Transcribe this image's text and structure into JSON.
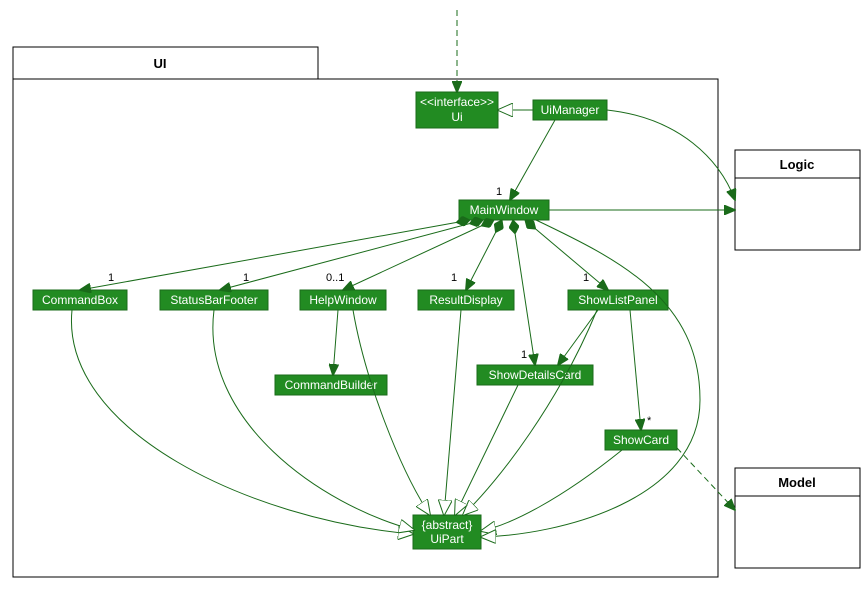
{
  "packages": {
    "ui": {
      "label": "UI"
    },
    "logic": {
      "label": "Logic"
    },
    "model": {
      "label": "Model"
    }
  },
  "classes": {
    "ui_iface": {
      "stereotype": "<<interface>>",
      "name": "Ui"
    },
    "uiManager": {
      "name": "UiManager"
    },
    "mainWindow": {
      "name": "MainWindow"
    },
    "commandBox": {
      "name": "CommandBox"
    },
    "statusBarFooter": {
      "name": "StatusBarFooter"
    },
    "helpWindow": {
      "name": "HelpWindow"
    },
    "resultDisplay": {
      "name": "ResultDisplay"
    },
    "showListPanel": {
      "name": "ShowListPanel"
    },
    "commandBuilder": {
      "name": "CommandBuilder"
    },
    "showDetailsCard": {
      "name": "ShowDetailsCard"
    },
    "showCard": {
      "name": "ShowCard"
    },
    "uiPart": {
      "stereotype": "{abstract}",
      "name": "UiPart"
    }
  },
  "multiplicities": {
    "mw": "1",
    "commandBox": "1",
    "statusBarFooter": "1",
    "helpWindow": "0..1",
    "resultDisplay": "1",
    "showListPanel": "1",
    "showDetailsCard": "1",
    "showCard": "*"
  }
}
